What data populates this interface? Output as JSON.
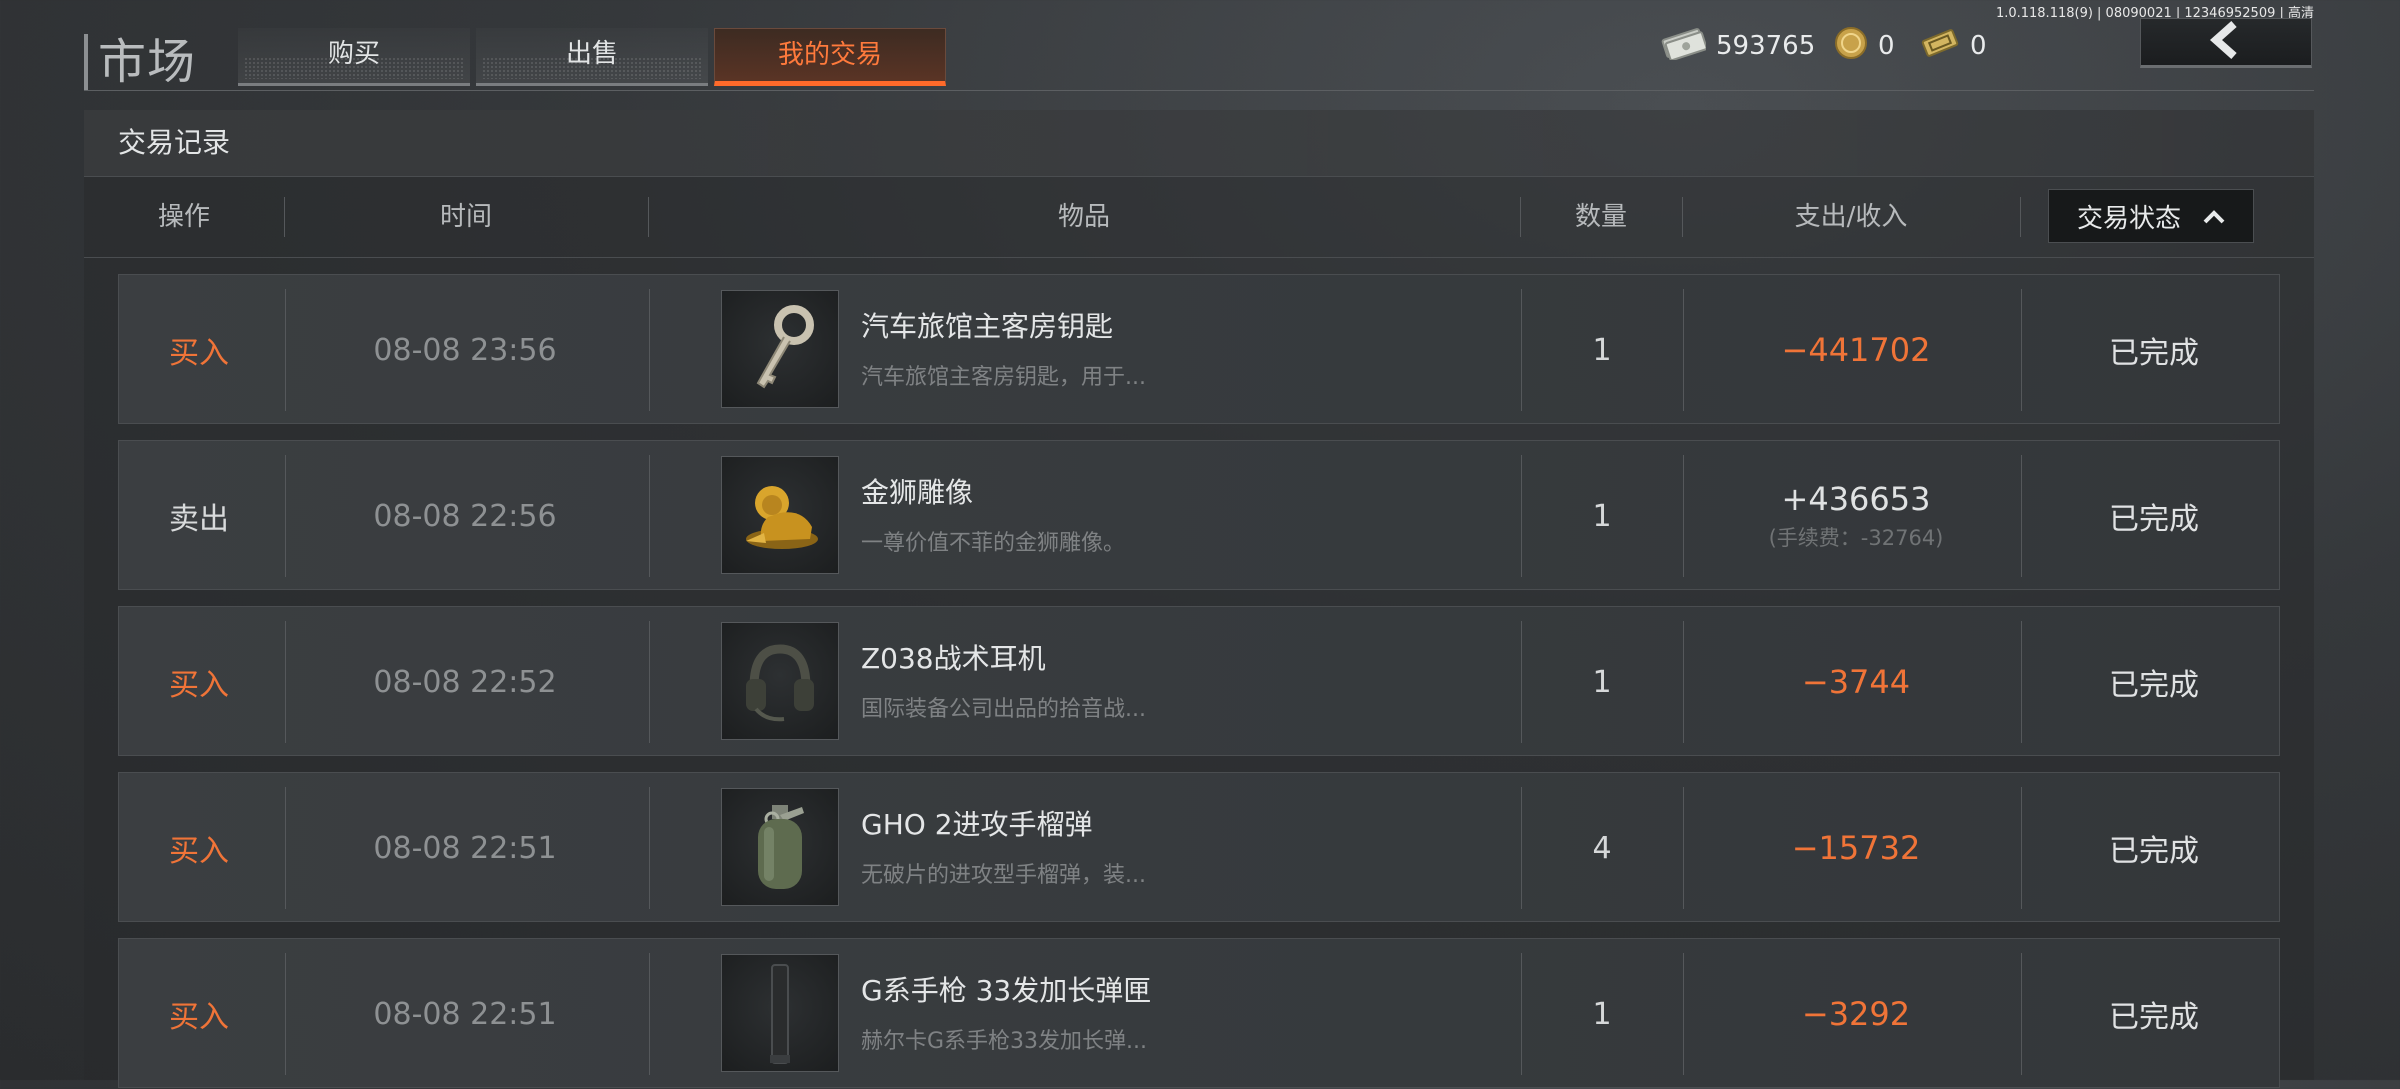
{
  "version_text": "1.0.118.118(9) | 08090021 | 12346952509 | 高清",
  "header": {
    "title": "市场",
    "tabs": [
      {
        "label": "购买",
        "active": false
      },
      {
        "label": "出售",
        "active": false
      },
      {
        "label": "我的交易",
        "active": true
      }
    ],
    "currencies": [
      {
        "icon": "cash-stack-icon",
        "value": "593765"
      },
      {
        "icon": "coin-icon",
        "value": "0"
      },
      {
        "icon": "ticket-icon",
        "value": "0"
      }
    ],
    "back_icon": "chevron-left-icon"
  },
  "panel": {
    "title": "交易记录",
    "columns": {
      "action": "操作",
      "time": "时间",
      "item": "物品",
      "quantity": "数量",
      "amount": "支出/收入",
      "status": "交易状态"
    }
  },
  "rows": [
    {
      "action": "买入",
      "type": "buy",
      "time": "08-08 23:56",
      "icon": "key-icon",
      "name": "汽车旅馆主客房钥匙",
      "desc": "汽车旅馆主客房钥匙，用于...",
      "qty": "1",
      "amount": "−441702",
      "sign": "neg",
      "fee": "",
      "status": "已完成"
    },
    {
      "action": "卖出",
      "type": "sell",
      "time": "08-08 22:56",
      "icon": "golden-lion-icon",
      "name": "金狮雕像",
      "desc": "一尊价值不菲的金狮雕像。",
      "qty": "1",
      "amount": "+436653",
      "sign": "pos",
      "fee": "(手续费：-32764)",
      "status": "已完成"
    },
    {
      "action": "买入",
      "type": "buy",
      "time": "08-08 22:52",
      "icon": "headset-icon",
      "name": "Z038战术耳机",
      "desc": "国际装备公司出品的拾音战...",
      "qty": "1",
      "amount": "−3744",
      "sign": "neg",
      "fee": "",
      "status": "已完成"
    },
    {
      "action": "买入",
      "type": "buy",
      "time": "08-08 22:51",
      "icon": "grenade-icon",
      "name": "GHO 2进攻手榴弹",
      "desc": "无破片的进攻型手榴弹，装...",
      "qty": "4",
      "amount": "−15732",
      "sign": "neg",
      "fee": "",
      "status": "已完成"
    },
    {
      "action": "买入",
      "type": "buy",
      "time": "08-08 22:51",
      "icon": "magazine-icon",
      "name": "G系手枪 33发加长弹匣",
      "desc": "赫尔卡G系手枪33发加长弹...",
      "qty": "1",
      "amount": "−3292",
      "sign": "neg",
      "fee": "",
      "status": "已完成"
    }
  ]
}
